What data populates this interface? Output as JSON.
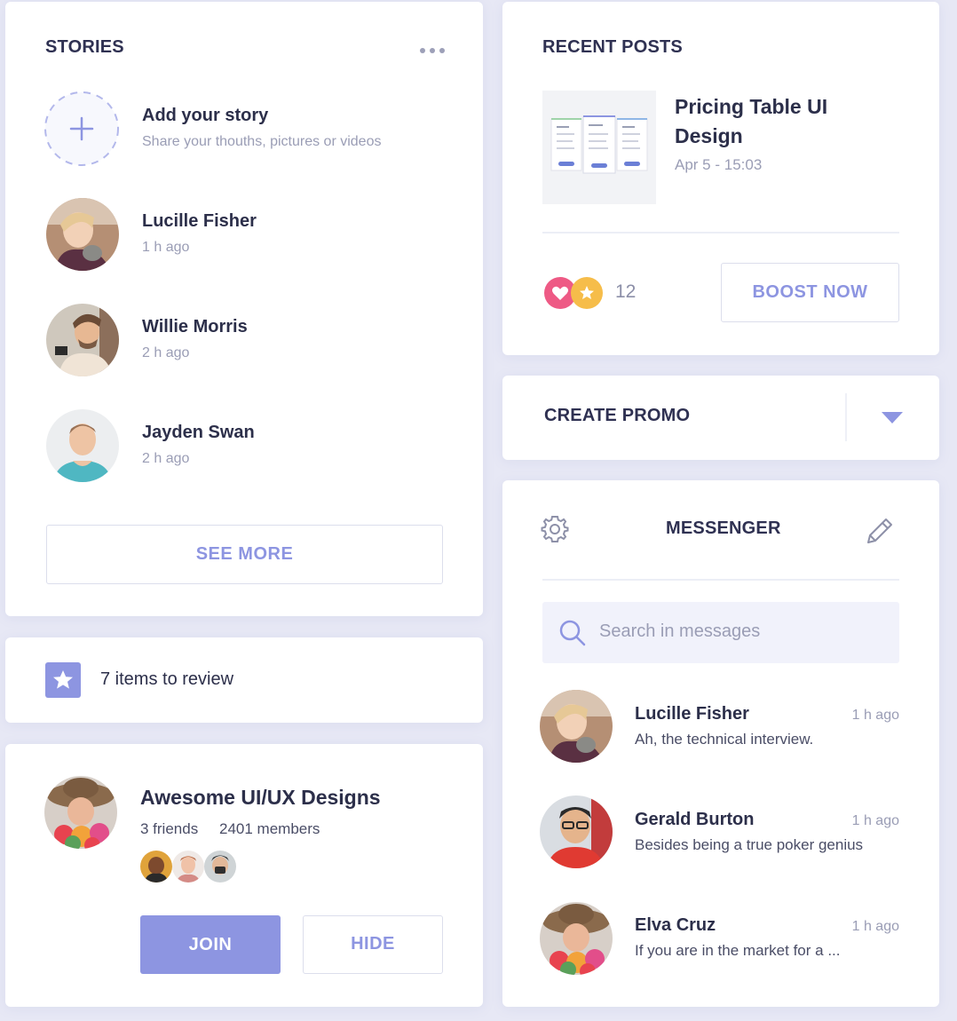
{
  "stories": {
    "title": "STORIES",
    "add": {
      "title": "Add your story",
      "subtitle": "Share your thouths, pictures or videos"
    },
    "items": [
      {
        "name": "Lucille Fisher",
        "time": "1 h ago"
      },
      {
        "name": "Willie Morris",
        "time": "2 h ago"
      },
      {
        "name": "Jayden Swan",
        "time": "2 h ago"
      }
    ],
    "see_more": "SEE MORE"
  },
  "review": {
    "text": "7 items to review"
  },
  "group": {
    "title": "Awesome UI/UX Designs",
    "friends": "3 friends",
    "members": "2401 members",
    "join": "JOIN",
    "hide": "HIDE"
  },
  "recent_posts": {
    "title": "RECENT POSTS",
    "post_title": "Pricing Table UI Design",
    "post_date": "Apr 5 - 15:03",
    "reaction_count": "12",
    "boost": "BOOST NOW"
  },
  "promo": {
    "title": "CREATE PROMO"
  },
  "messenger": {
    "title": "MESSENGER",
    "search_placeholder": "Search in messages",
    "messages": [
      {
        "name": "Lucille Fisher",
        "time": "1 h ago",
        "text": "Ah, the technical interview."
      },
      {
        "name": "Gerald Burton",
        "time": "1 h ago",
        "text": "Besides being a true poker genius"
      },
      {
        "name": "Elva Cruz",
        "time": "1 h ago",
        "text": "If you are in the market for a ..."
      }
    ]
  },
  "colors": {
    "accent": "#8d95e1",
    "heart": "#ee5a85",
    "star": "#f6bd4a"
  }
}
